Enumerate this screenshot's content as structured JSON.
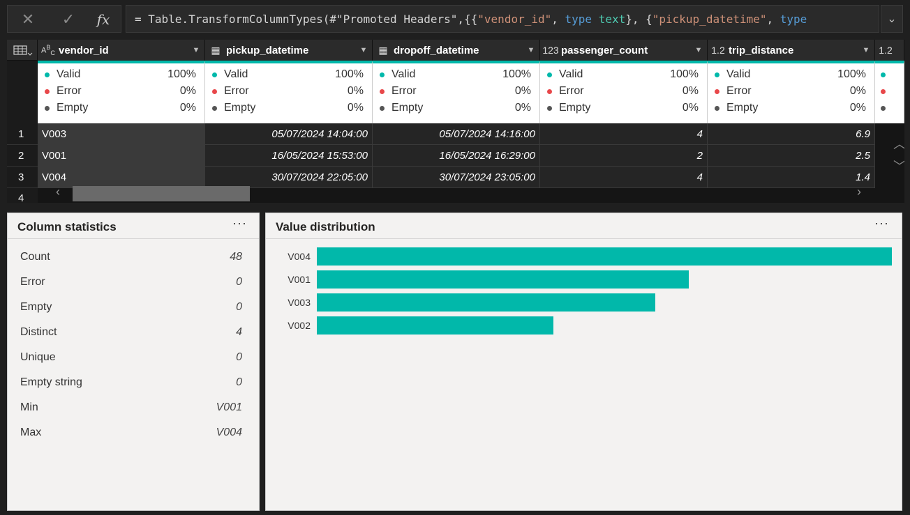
{
  "formula": {
    "cancel_icon": "close-icon",
    "commit_icon": "check-icon",
    "fx_label": "fx",
    "prefix": "= Table.TransformColumnTypes(#\"Promoted Headers\",{{",
    "s1": "\"vendor_id\"",
    "sep1": ", ",
    "kw1": "type",
    "sp1": " ",
    "t1": "text",
    "mid": "}, {",
    "s2": "\"pickup_datetime\"",
    "sep2": ", ",
    "kw2": "type",
    "expand_icon": "chevron-down-icon"
  },
  "grid": {
    "columns": [
      {
        "type_label": "ABC",
        "name": "vendor_id"
      },
      {
        "type_label": "cal",
        "name": "pickup_datetime"
      },
      {
        "type_label": "cal",
        "name": "dropoff_datetime"
      },
      {
        "type_label": "123",
        "name": "passenger_count"
      },
      {
        "type_label": "1.2",
        "name": "trip_distance"
      },
      {
        "type_label": "1.2",
        "name": ""
      }
    ],
    "quality": [
      {
        "valid": "100%",
        "error": "0%",
        "empty": "0%"
      },
      {
        "valid": "100%",
        "error": "0%",
        "empty": "0%"
      },
      {
        "valid": "100%",
        "error": "0%",
        "empty": "0%"
      },
      {
        "valid": "100%",
        "error": "0%",
        "empty": "0%"
      },
      {
        "valid": "100%",
        "error": "0%",
        "empty": "0%"
      }
    ],
    "quality_labels": {
      "valid": "Valid",
      "error": "Error",
      "empty": "Empty"
    },
    "rows": [
      {
        "n": "1",
        "vendor_id": "V003",
        "pickup": "05/07/2024 14:04:00",
        "dropoff": "05/07/2024 14:16:00",
        "passengers": "4",
        "distance": "6.9"
      },
      {
        "n": "2",
        "vendor_id": "V001",
        "pickup": "16/05/2024 15:53:00",
        "dropoff": "16/05/2024 16:29:00",
        "passengers": "2",
        "distance": "2.5"
      },
      {
        "n": "3",
        "vendor_id": "V004",
        "pickup": "30/07/2024 22:05:00",
        "dropoff": "30/07/2024 23:05:00",
        "passengers": "4",
        "distance": "1.4"
      },
      {
        "n": "4"
      }
    ]
  },
  "stats": {
    "title": "Column statistics",
    "menu": "···",
    "items": [
      {
        "label": "Count",
        "value": "48"
      },
      {
        "label": "Error",
        "value": "0"
      },
      {
        "label": "Empty",
        "value": "0"
      },
      {
        "label": "Distinct",
        "value": "4"
      },
      {
        "label": "Unique",
        "value": "0"
      },
      {
        "label": "Empty string",
        "value": "0"
      },
      {
        "label": "Min",
        "value": "V001"
      },
      {
        "label": "Max",
        "value": "V004"
      }
    ]
  },
  "distribution": {
    "title": "Value distribution",
    "menu": "···",
    "bar_color": "#01b8aa"
  },
  "chart_data": {
    "type": "bar",
    "orientation": "horizontal",
    "categories": [
      "V004",
      "V001",
      "V003",
      "V002"
    ],
    "values": [
      17,
      11,
      10,
      7
    ]
  },
  "colors": {
    "valid": "#01b8aa",
    "error": "#e8474a",
    "empty": "#555555"
  }
}
